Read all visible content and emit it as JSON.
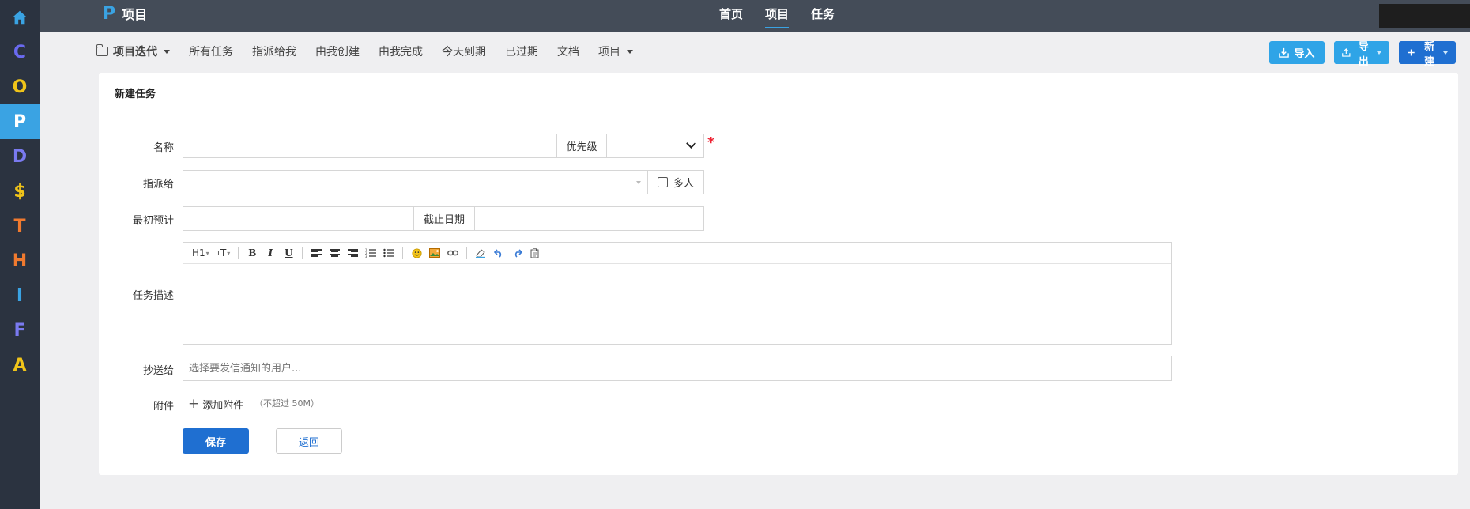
{
  "leftbar": {
    "apps": [
      {
        "letter": "C",
        "color": "#6a6af0"
      },
      {
        "letter": "O",
        "color": "#f0c419"
      },
      {
        "letter": "P",
        "color": "#ffffff",
        "active": true
      },
      {
        "letter": "D",
        "color": "#7a7af0"
      },
      {
        "letter": "$",
        "color": "#f0c419"
      },
      {
        "letter": "T",
        "color": "#f07a2f"
      },
      {
        "letter": "H",
        "color": "#f07a2f"
      },
      {
        "letter": "I",
        "color": "#3aa3e3"
      },
      {
        "letter": "F",
        "color": "#7a7af0"
      },
      {
        "letter": "A",
        "color": "#f0c419"
      }
    ]
  },
  "brand": {
    "logo": "P",
    "name": "项目"
  },
  "topnav": {
    "home": "首页",
    "project": "项目",
    "task": "任务"
  },
  "subnav": {
    "iteration": "项目迭代",
    "all_tasks": "所有任务",
    "assigned_to_me": "指派给我",
    "created_by_me": "由我创建",
    "done_by_me": "由我完成",
    "due_today": "今天到期",
    "overdue": "已过期",
    "docs": "文档",
    "project": "项目"
  },
  "actions": {
    "import": "导入",
    "export": "导出",
    "new": "新建"
  },
  "form": {
    "title": "新建任务",
    "name_label": "名称",
    "name_value": "",
    "priority_label": "优先级",
    "priority_value": "",
    "assign_label": "指派给",
    "assign_value": "",
    "multi_label": "多人",
    "estimate_label": "最初预计",
    "estimate_value": "",
    "deadline_label": "截止日期",
    "deadline_value": "",
    "desc_label": "任务描述",
    "toolbar": {
      "heading": "H1",
      "font_size": "T"
    },
    "cc_label": "抄送给",
    "cc_placeholder": "选择要发信通知的用户...",
    "attach_label": "附件",
    "attach_button": "添加附件",
    "attach_hint": "（不超过 50M）",
    "save": "保存",
    "back": "返回"
  },
  "colors": {
    "accent": "#3aa3e3",
    "primary": "#1f6fd1",
    "required": "#e23333"
  }
}
